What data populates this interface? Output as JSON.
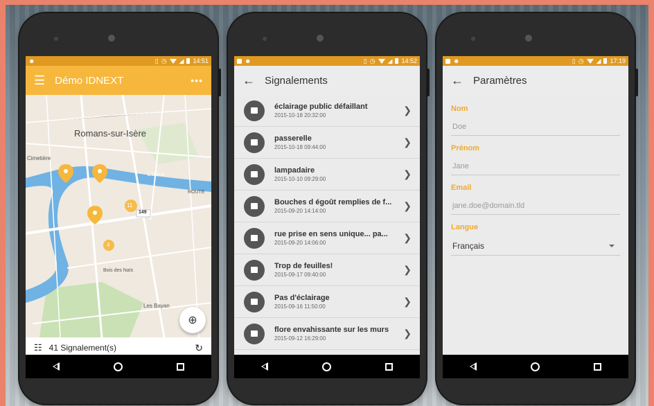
{
  "colors": {
    "accent": "#f6b73c",
    "status": "#e09a22",
    "label": "#f0a930"
  },
  "phone1": {
    "time": "14:51",
    "appbar": {
      "title": "Démo IDNEXT",
      "menu_icon": "hamburger-icon",
      "more_icon": "more-icon"
    },
    "map": {
      "city": "Romans-sur-Isère",
      "labels": [
        "Cimetière",
        "L'Isère",
        "ROUTE",
        "Bois des Naïs",
        "Les Bayan"
      ],
      "road_badge": "149",
      "clusters": [
        "11",
        "4"
      ]
    },
    "bottom": {
      "count": "41 Signalement(s)"
    }
  },
  "phone2": {
    "time": "14:52",
    "appbar": {
      "title": "Signalements"
    },
    "items": [
      {
        "title": "éclairage public défaillant",
        "date": "2015-10-18 20:32:00"
      },
      {
        "title": "passerelle",
        "date": "2015-10-18 09:44:00"
      },
      {
        "title": "lampadaire",
        "date": "2015-10-10 09:29:00"
      },
      {
        "title": "Bouches d égoût remplies de f...",
        "date": "2015-09-20 14:14:00"
      },
      {
        "title": "rue prise en sens unique... pa...",
        "date": "2015-09-20 14:06:00"
      },
      {
        "title": "Trop de feuilles!",
        "date": "2015-09-17 09:40:00"
      },
      {
        "title": "Pas d'éclairage",
        "date": "2015-09-16 11:50:00"
      },
      {
        "title": "flore envahissante sur les murs",
        "date": "2015-09-12 16:29:00"
      }
    ]
  },
  "phone3": {
    "time": "17:19",
    "appbar": {
      "title": "Paramètres"
    },
    "fields": {
      "nom": {
        "label": "Nom",
        "placeholder": "Doe"
      },
      "prenom": {
        "label": "Prénom",
        "placeholder": "Jane"
      },
      "email": {
        "label": "Email",
        "placeholder": "jane.doe@domain.tld"
      },
      "langue": {
        "label": "Langue",
        "value": "Français"
      }
    }
  }
}
